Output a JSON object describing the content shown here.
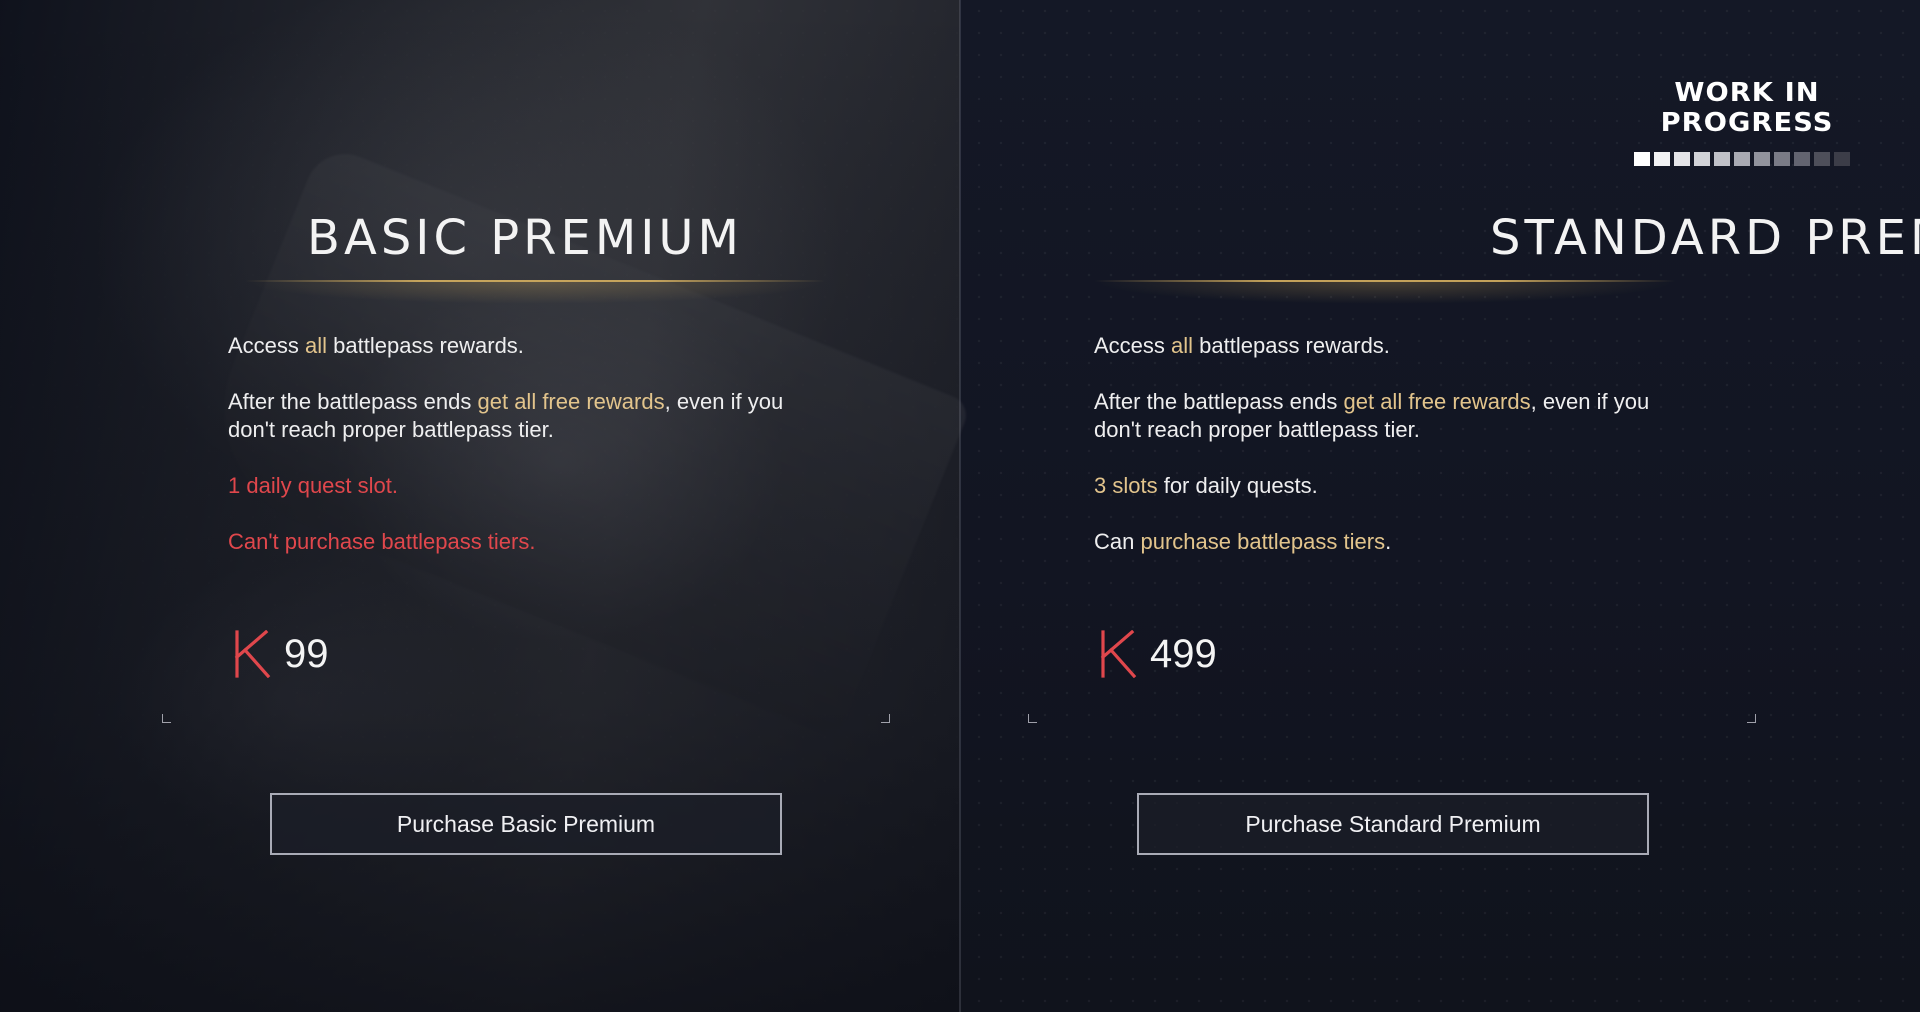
{
  "wip": {
    "line1": "WORK IN",
    "line2": "PROGRESS",
    "segments": 11,
    "segment_colors": [
      "#ffffff",
      "#f2f2f4",
      "#e4e4e8",
      "#d2d3d8",
      "#c0c1c8",
      "#a9aab3",
      "#92939d",
      "#7a7b86",
      "#636470",
      "#4e4f5a",
      "#3c3d48"
    ]
  },
  "colors": {
    "highlight": "#e2c48c",
    "negative": "#e0474c",
    "k_icon": "#e0474c"
  },
  "basic": {
    "title": "BASIC PREMIUM",
    "feature1": {
      "pre": "Access ",
      "hl": "all",
      "post": " battlepass rewards."
    },
    "feature2": {
      "pre": "After the battlepass ends ",
      "hl": "get all free rewards",
      "post": ", even if you don't reach proper battlepass tier."
    },
    "feature3": "1 daily quest slot.",
    "feature4": "Can't purchase battlepass tiers.",
    "currency_icon": "k-currency-icon",
    "price": "99",
    "button_label": "Purchase Basic Premium"
  },
  "standard": {
    "title": "STANDARD PREMIUM",
    "feature1": {
      "pre": "Access ",
      "hl": "all",
      "post": " battlepass rewards."
    },
    "feature2": {
      "pre": "After the battlepass ends ",
      "hl": "get all free rewards",
      "post": ", even if you don't reach proper battlepass tier."
    },
    "feature3": {
      "hl": "3 slots",
      "post": " for daily quests."
    },
    "feature4": {
      "pre": "Can ",
      "hl": "purchase battlepass tiers",
      "post": "."
    },
    "currency_icon": "k-currency-icon",
    "price": "499",
    "button_label": "Purchase Standard Premium"
  }
}
